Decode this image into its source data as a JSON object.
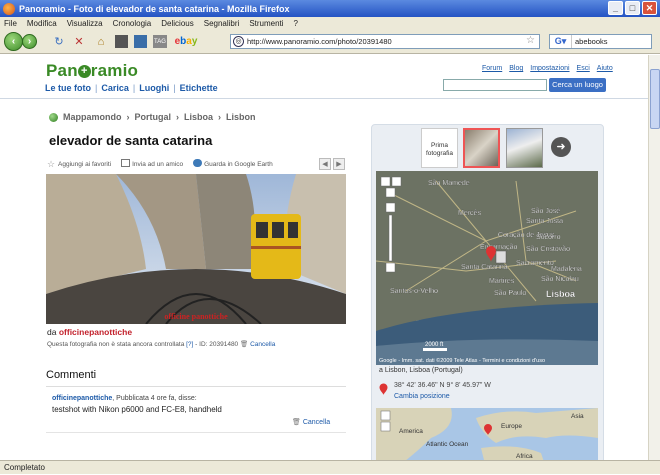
{
  "window": {
    "title": "Panoramio - Foto di elevador de santa catarina - Mozilla Firefox"
  },
  "menu": [
    "File",
    "Modifica",
    "Visualizza",
    "Cronologia",
    "Delicious",
    "Segnalibri",
    "Strumenti",
    "?"
  ],
  "url": "http://www.panoramio.com/photo/20391480",
  "search_engine_value": "abebooks",
  "site": {
    "logo": "Panoramio",
    "nav": [
      "Le tue foto",
      "Carica",
      "Luoghi",
      "Etichette"
    ],
    "toplinks": [
      "Forum",
      "Blog",
      "Impostazioni",
      "Esci",
      "Aiuto"
    ],
    "search_button": "Cerca un luogo"
  },
  "breadcrumb": [
    "Mappamondo",
    "Portugal",
    "Lisboa",
    "Lisbon"
  ],
  "photo": {
    "title": "elevador de santa catarina",
    "actions": [
      "Aggiungi ai favoriti",
      "Invia ad un amico",
      "Guarda in Google Earth"
    ],
    "by_prefix": "da",
    "author": "officinepanottiche",
    "pending_note": "Questa fotografia non è stata ancora controllata",
    "help": "[?]",
    "id_text": "- ID: 20391480",
    "cancel_label": "Cancella",
    "watermark": "officine panottiche"
  },
  "comments": {
    "heading": "Commenti",
    "items": [
      {
        "author": "officinepanottiche",
        "meta": ", Pubblicata 4 ore fa, disse:",
        "text": "testshot with Nikon p6000 and FC-E8, handheld"
      }
    ],
    "cancel_label": "Cancella"
  },
  "side": {
    "first_photo_label": "Prima fotografia",
    "map_labels": [
      "São Mamede",
      "Mercês",
      "São José",
      "Santa Justa",
      "Coração de Jesus",
      "Encarnação",
      "São Cristóvão",
      "Santa Catarina",
      "Sacramento",
      "Mártires",
      "São Paulo",
      "Santos-o-Velho",
      "Lisboa",
      "São Nicolau",
      "Madalena",
      "Socorro"
    ],
    "scale": "2000 ft",
    "attribution": "Google - Imm. sat. dati ©2009 Tele Atlas - Termini e condizioni d'uso",
    "location": "a Lisbon, Lisboa (Portugal)",
    "coords": "38° 42' 36.46\" N  9° 8' 45.97\" W",
    "change_position": "Cambia posizione",
    "minimap_labels": [
      "Asia",
      "Europe",
      "America",
      "Atlantic Ocean",
      "Africa"
    ]
  },
  "status": "Completato",
  "colors": {
    "brand_green": "#3a8a26",
    "link_blue": "#1d5aa8",
    "author_red": "#c2202b"
  }
}
